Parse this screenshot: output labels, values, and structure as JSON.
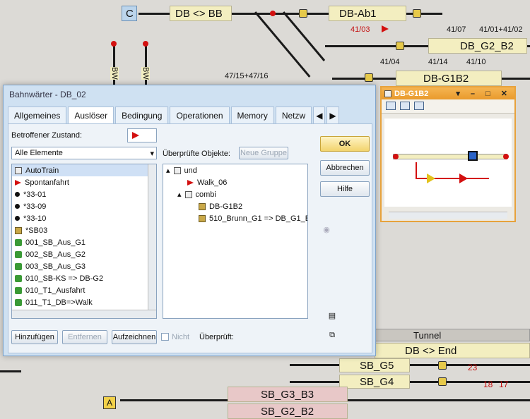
{
  "layout_bg": {
    "block_c": "C",
    "block_db_bb": "DB <> BB",
    "block_db_ab1": "DB-Ab1",
    "num_4103": "41/03",
    "num_4107": "41/07",
    "num_4101_4102": "41/01+41/02",
    "block_db_g2_b2": "DB_G2_B2",
    "num_4104": "41/04",
    "num_4114": "41/14",
    "num_4110": "41/10",
    "num_4715_4716": "47/15+47/16",
    "block_db_g1b2": "DB-G1B2",
    "bw1": "BW",
    "bw2": "BW",
    "tunnel": "Tunnel",
    "db_end": "DB <> End",
    "sb_g5": "SB_G5",
    "sb_g4": "SB_G4",
    "sb_g3_b3": "SB_G3_B3",
    "sb_g2_b2": "SB_G2_B2",
    "n23": "23",
    "n18": "18",
    "n17": "17",
    "badge_a": "A"
  },
  "dialog": {
    "title": "Bahnwärter - DB_02",
    "tabs": [
      {
        "label": "Allgemeines"
      },
      {
        "label": "Auslöser"
      },
      {
        "label": "Bedingung"
      },
      {
        "label": "Operationen"
      },
      {
        "label": "Memory"
      },
      {
        "label": "Netzw"
      }
    ],
    "tab_arrow_left": "◀",
    "tab_arrow_right": "▶",
    "state_label": "Betroffener Zustand:",
    "filter_value": "Alle Elemente",
    "elements": [
      {
        "label": "AutoTrain",
        "icon": "letter-a-icon"
      },
      {
        "label": "Spontanfahrt",
        "icon": "flag-icon"
      },
      {
        "label": "*33-01",
        "icon": "dot-icon"
      },
      {
        "label": "*33-09",
        "icon": "dot-icon"
      },
      {
        "label": "*33-10",
        "icon": "dot-icon"
      },
      {
        "label": "*SB03",
        "icon": "block-icon"
      },
      {
        "label": "001_SB_Aus_G1",
        "icon": "route-icon"
      },
      {
        "label": "002_SB_Aus_G2",
        "icon": "route-icon"
      },
      {
        "label": "003_SB_Aus_G3",
        "icon": "route-icon"
      },
      {
        "label": "010_SB-KS => DB-G2",
        "icon": "route-icon"
      },
      {
        "label": "010_T1_Ausfahrt",
        "icon": "route-icon"
      },
      {
        "label": "011_T1_DB=>Walk",
        "icon": "route-icon"
      }
    ],
    "checked_objects_label": "Überprüfte Objekte:",
    "new_group_label": "Neue Gruppe",
    "tree": {
      "root": "und",
      "walk": "Walk_06",
      "combi": "combi",
      "g1b2": "DB-G1B2",
      "route": "510_Brunn_G1 => DB_G1_E"
    },
    "ok_label": "OK",
    "cancel_label": "Abbrechen",
    "help_label": "Hilfe",
    "add_label": "Hinzufügen",
    "remove_label": "Entfernen",
    "record_label": "Aufzeichnen",
    "not_label": "Nicht",
    "check_label": "Überprüft:"
  },
  "mini_window": {
    "title": "DB-G1B2",
    "controls": "▾ – □ ✕"
  }
}
